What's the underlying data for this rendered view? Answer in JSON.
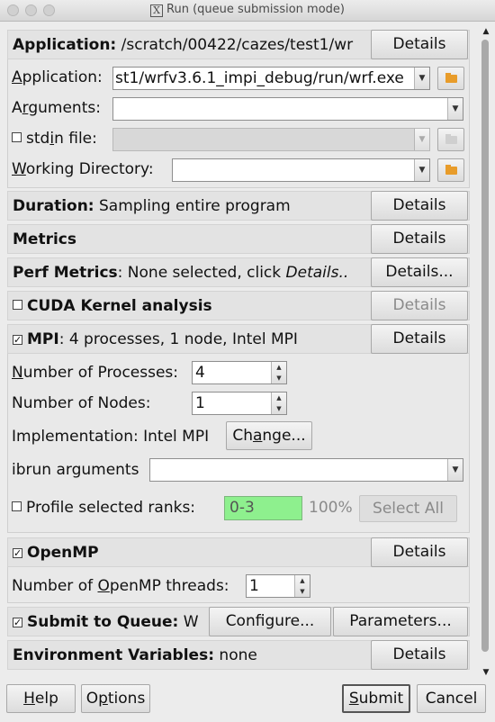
{
  "window": {
    "title": "Run (queue submission mode)"
  },
  "application_section": {
    "header_label": "Application:",
    "header_value": "/scratch/00422/cazes/test1/wr",
    "details_button": "Details",
    "application_label_mnemonic": "A",
    "application_label_rest": "pplication:",
    "application_value": "st1/wrfv3.6.1_impi_debug/run/wrf.exe",
    "arguments_label_mnemonic": "r",
    "arguments_label_pre": "A",
    "arguments_label_post": "guments:",
    "arguments_value": "",
    "stdin_label_pre": "std",
    "stdin_label_mnemonic": "i",
    "stdin_label_post": "n file:",
    "stdin_value": "",
    "working_dir_label_mnemonic": "W",
    "working_dir_label_rest": "orking Directory:",
    "working_dir_value": ""
  },
  "duration": {
    "label": "Duration:",
    "value": "Sampling entire program",
    "button": "Details"
  },
  "metrics": {
    "label": "Metrics",
    "button": "Details"
  },
  "perf_metrics": {
    "label": "Perf Metrics",
    "value_pre": ": None selected, click ",
    "value_italic": "Details..",
    "button": "Details..."
  },
  "cuda": {
    "label": "CUDA Kernel analysis",
    "button": "Details",
    "checked": false
  },
  "mpi": {
    "label": "MPI",
    "summary": ": 4 processes, 1 node, Intel MPI",
    "button": "Details",
    "checked": true,
    "num_processes_label_mnemonic": "N",
    "num_processes_label_rest": "umber of Processes:",
    "num_processes_value": "4",
    "num_nodes_label": "Number of Nodes:",
    "num_nodes_value": "1",
    "implementation_label": "Implementation: Intel MPI",
    "change_button_pre": "Ch",
    "change_button_mnemonic": "a",
    "change_button_post": "nge...",
    "ibrun_label": "ibrun arguments",
    "ibrun_value": "",
    "profile_label": "Profile selected ranks:",
    "profile_value": "0-3",
    "profile_percent": "100%",
    "select_all_button": "Select All"
  },
  "openmp": {
    "label": "OpenMP",
    "button": "Details",
    "checked": true,
    "threads_label_pre": "Number of ",
    "threads_label_mnemonic": "O",
    "threads_label_post": "penMP threads:",
    "threads_value": "1"
  },
  "queue": {
    "label": "Submit to Queue:",
    "label_cut": "W",
    "checked": true,
    "configure_button": "Configure...",
    "parameters_button": "Parameters..."
  },
  "env": {
    "label": "Environment Variables:",
    "value": "none",
    "button": "Details"
  },
  "footer": {
    "help_mnemonic": "H",
    "help_rest": "elp",
    "options_pre": "O",
    "options_mnemonic": "p",
    "options_post": "tions",
    "submit_mnemonic": "S",
    "submit_rest": "ubmit",
    "cancel": "Cancel"
  }
}
